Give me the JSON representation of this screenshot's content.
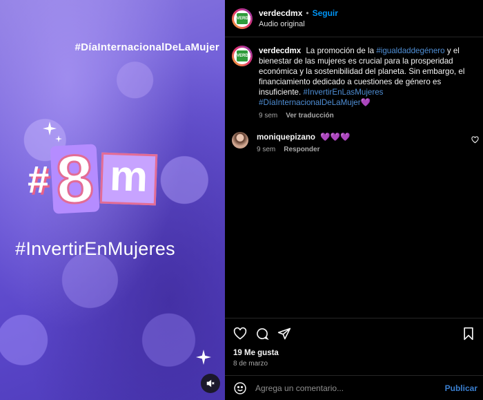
{
  "media": {
    "tag_top": "#DíaInternacionalDeLaMujer",
    "hash": "#",
    "eight": "8",
    "m": "m",
    "tag_main": "#InvertirEnMujeres",
    "mute_icon": "speaker-muted-icon"
  },
  "header": {
    "username": "verdecdmx",
    "dot": "•",
    "follow": "Seguir",
    "audio": "Audio original",
    "logo_text": "VERDE"
  },
  "caption": {
    "username": "verdecdmx",
    "text_1": "La promoción de la",
    "hashtag_1": "#igualdaddegénero",
    "text_2": "y el bienestar de las mujeres es crucial para la prosperidad económica y la sostenibilidad del planeta. Sin embargo, el financiamiento dedicado a cuestiones de género es insuficiente.",
    "hashtag_2": "#InvertirEnLasMujeres",
    "hashtag_3": "#DíaInternacionalDeLaMujer",
    "emoji": "💜",
    "time": "9 sem",
    "translate": "Ver traducción"
  },
  "comment": {
    "username": "moniquepizano",
    "text": "💜💜💜",
    "time": "9 sem",
    "reply": "Responder"
  },
  "actions": {
    "likes": "19 Me gusta",
    "date": "8 de marzo"
  },
  "add_comment": {
    "placeholder": "Agrega un comentario...",
    "publish": "Publicar"
  },
  "colors": {
    "accent": "#0095f6",
    "hashtag": "#4f8fd6",
    "media_purple": "#6a57d6",
    "pink": "#e36c95"
  }
}
